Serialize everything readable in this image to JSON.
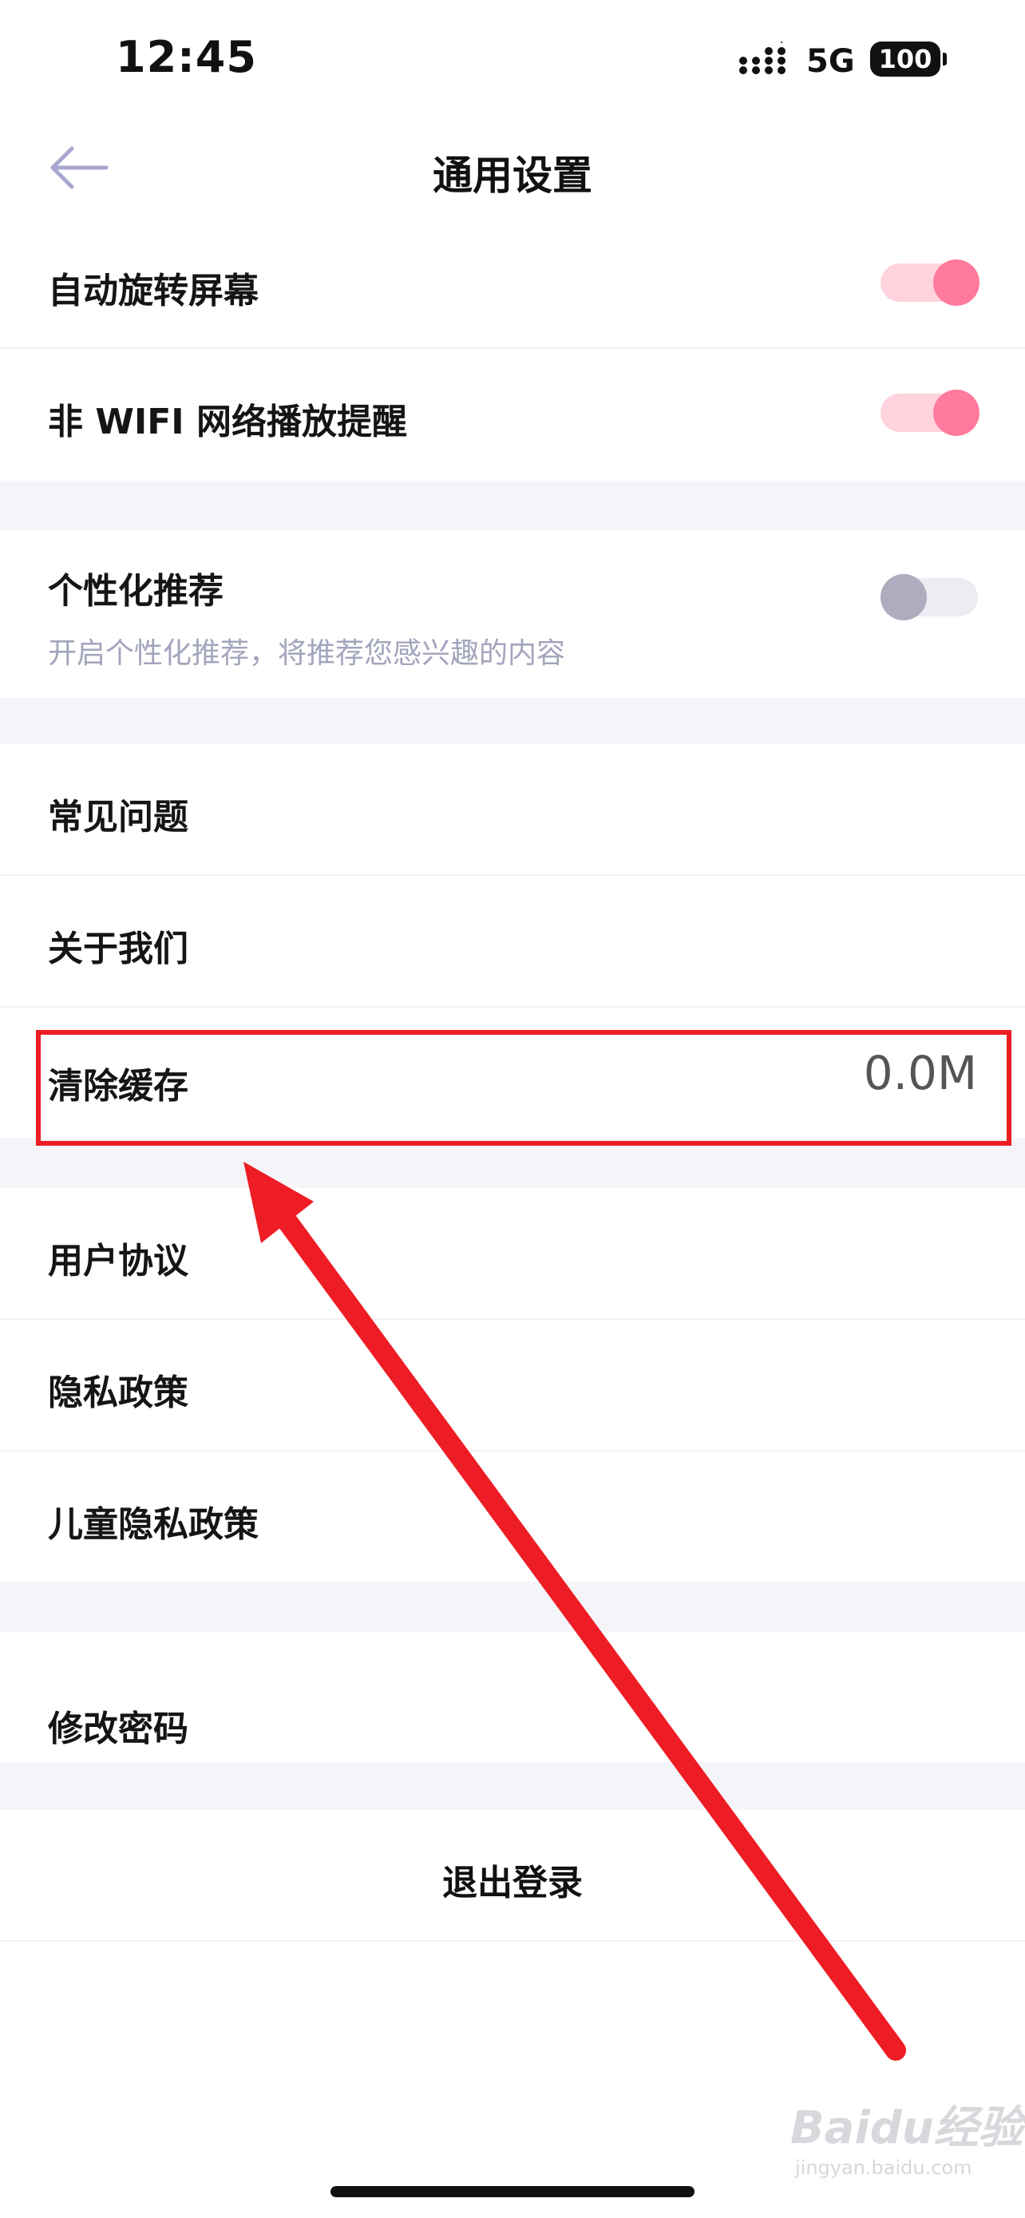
{
  "status_bar": {
    "time": "12:45",
    "network": "5G",
    "battery": "100"
  },
  "nav": {
    "title": "通用设置"
  },
  "settings": {
    "auto_rotate": {
      "label": "自动旋转屏幕",
      "enabled": true
    },
    "non_wifi_alert": {
      "label": "非 WIFI 网络播放提醒",
      "enabled": true
    },
    "personalized": {
      "label": "个性化推荐",
      "description": "开启个性化推荐，将推荐您感兴趣的内容",
      "enabled": false
    },
    "faq": {
      "label": "常见问题"
    },
    "about": {
      "label": "关于我们"
    },
    "clear_cache": {
      "label": "清除缓存",
      "value": "0.0M"
    },
    "user_agreement": {
      "label": "用户协议"
    },
    "privacy_policy": {
      "label": "隐私政策"
    },
    "child_privacy": {
      "label": "儿童隐私政策"
    },
    "change_password": {
      "label": "修改密码"
    },
    "logout": {
      "label": "退出登录"
    }
  },
  "watermark": {
    "main": "Baidu经验",
    "sub": "jingyan.baidu.com"
  },
  "colors": {
    "toggle_on": "#ff7a9d",
    "toggle_off": "#adadbf",
    "annotation": "#ee1c24"
  }
}
